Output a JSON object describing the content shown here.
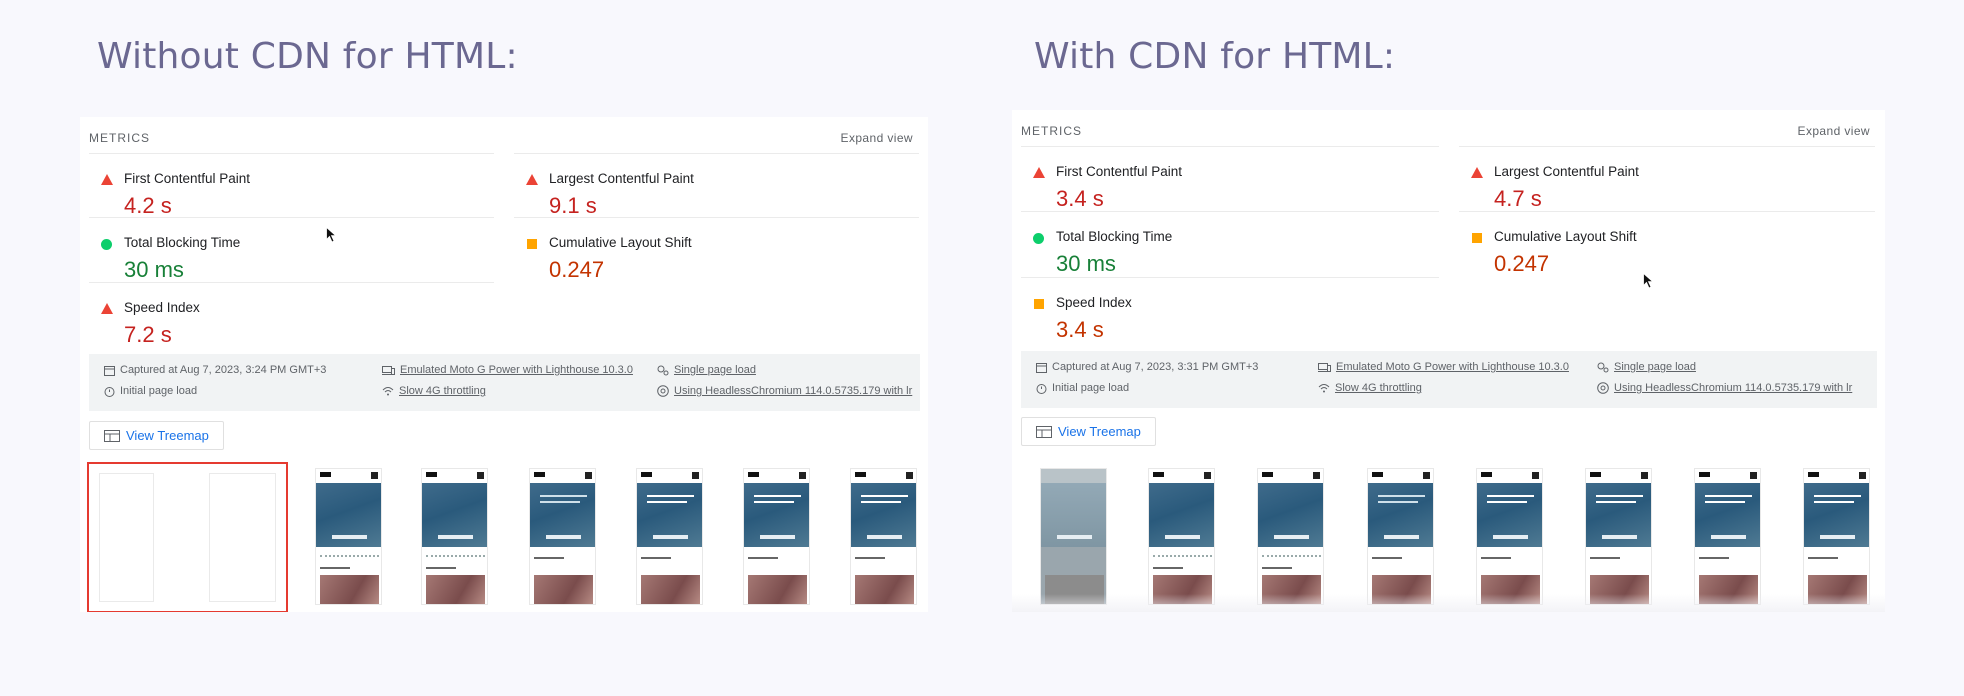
{
  "headings": {
    "left": "Without CDN for HTML:",
    "right": "With CDN for HTML:"
  },
  "colors": {
    "bad": "#eb4335",
    "good": "#0cce6b",
    "average": "#ffa400",
    "link": "#1a73e8",
    "heading": "#6b6891"
  },
  "reports": [
    {
      "metrics_title": "METRICS",
      "expand_label": "Expand view",
      "metrics": [
        {
          "label": "First Contentful Paint",
          "value": "4.2 s",
          "status": "bad",
          "icon": "red-triangle-icon"
        },
        {
          "label": "Largest Contentful Paint",
          "value": "9.1 s",
          "status": "bad",
          "icon": "red-triangle-icon"
        },
        {
          "label": "Total Blocking Time",
          "value": "30 ms",
          "status": "good",
          "icon": "green-circle-icon"
        },
        {
          "label": "Cumulative Layout Shift",
          "value": "0.247",
          "status": "average",
          "icon": "orange-square-icon"
        },
        {
          "label": "Speed Index",
          "value": "7.2 s",
          "status": "bad",
          "icon": "red-triangle-icon"
        }
      ],
      "info": {
        "captured": "Captured at Aug 7, 2023, 3:24 PM GMT+3",
        "initial_load": "Initial page load",
        "device": "Emulated Moto G Power with Lighthouse 10.3.0",
        "throttling": "Slow 4G throttling",
        "session": "Single page load",
        "browser": "Using HeadlessChromium 114.0.5735.179 with lr"
      },
      "treemap_label": "View Treemap"
    },
    {
      "metrics_title": "METRICS",
      "expand_label": "Expand view",
      "metrics": [
        {
          "label": "First Contentful Paint",
          "value": "3.4 s",
          "status": "bad",
          "icon": "red-triangle-icon"
        },
        {
          "label": "Largest Contentful Paint",
          "value": "4.7 s",
          "status": "bad",
          "icon": "red-triangle-icon"
        },
        {
          "label": "Total Blocking Time",
          "value": "30 ms",
          "status": "good",
          "icon": "green-circle-icon"
        },
        {
          "label": "Cumulative Layout Shift",
          "value": "0.247",
          "status": "average",
          "icon": "orange-square-icon"
        },
        {
          "label": "Speed Index",
          "value": "3.4 s",
          "status": "average",
          "icon": "orange-square-icon"
        }
      ],
      "info": {
        "captured": "Captured at Aug 7, 2023, 3:31 PM GMT+3",
        "initial_load": "Initial page load",
        "device": "Emulated Moto G Power with Lighthouse 10.3.0",
        "throttling": "Slow 4G throttling",
        "session": "Single page load",
        "browser": "Using HeadlessChromium 114.0.5735.179 with lr"
      },
      "treemap_label": "View Treemap"
    }
  ]
}
